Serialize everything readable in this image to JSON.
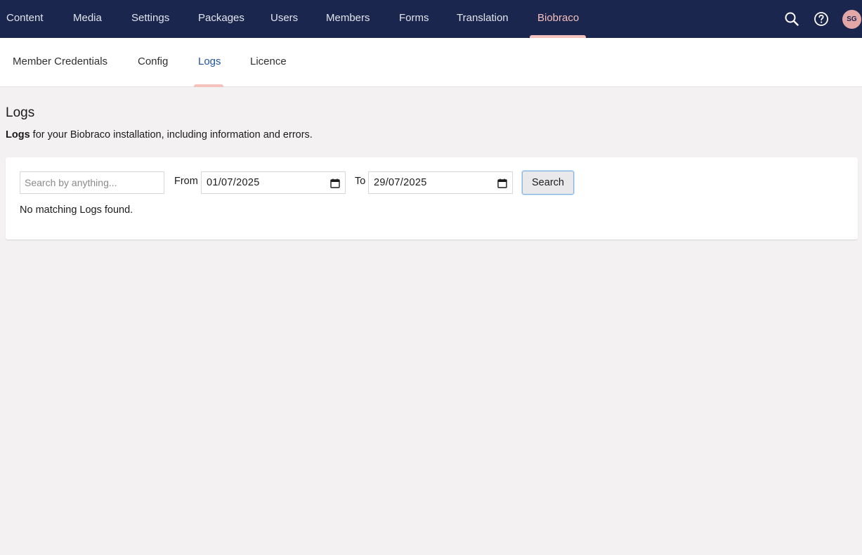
{
  "topnav": {
    "items": [
      {
        "label": "Content"
      },
      {
        "label": "Media"
      },
      {
        "label": "Settings"
      },
      {
        "label": "Packages"
      },
      {
        "label": "Users"
      },
      {
        "label": "Members"
      },
      {
        "label": "Forms"
      },
      {
        "label": "Translation"
      },
      {
        "label": "Biobraco",
        "active": true
      }
    ],
    "icons": [
      "search-icon",
      "help-icon"
    ],
    "avatar_initials": "SG"
  },
  "subnav": {
    "items": [
      {
        "label": "Member Credentials"
      },
      {
        "label": "Config"
      },
      {
        "label": "Logs",
        "active": true
      },
      {
        "label": "Licence"
      }
    ]
  },
  "page": {
    "title": "Logs",
    "description_bold": "Logs",
    "description_rest": " for your Biobraco installation, including information and errors."
  },
  "filters": {
    "search_placeholder": "Search by anything...",
    "search_value": "",
    "from_label": "From",
    "from_value": "01/07/2025",
    "to_label": "To",
    "to_value": "29/07/2025",
    "search_button": "Search"
  },
  "results": {
    "empty_message": "No matching Logs found."
  },
  "colors": {
    "nav_background": "#1b264f",
    "active_accent": "#f5c1bc",
    "active_subnav_text": "#2152a3",
    "page_background": "#f3f1f1"
  }
}
